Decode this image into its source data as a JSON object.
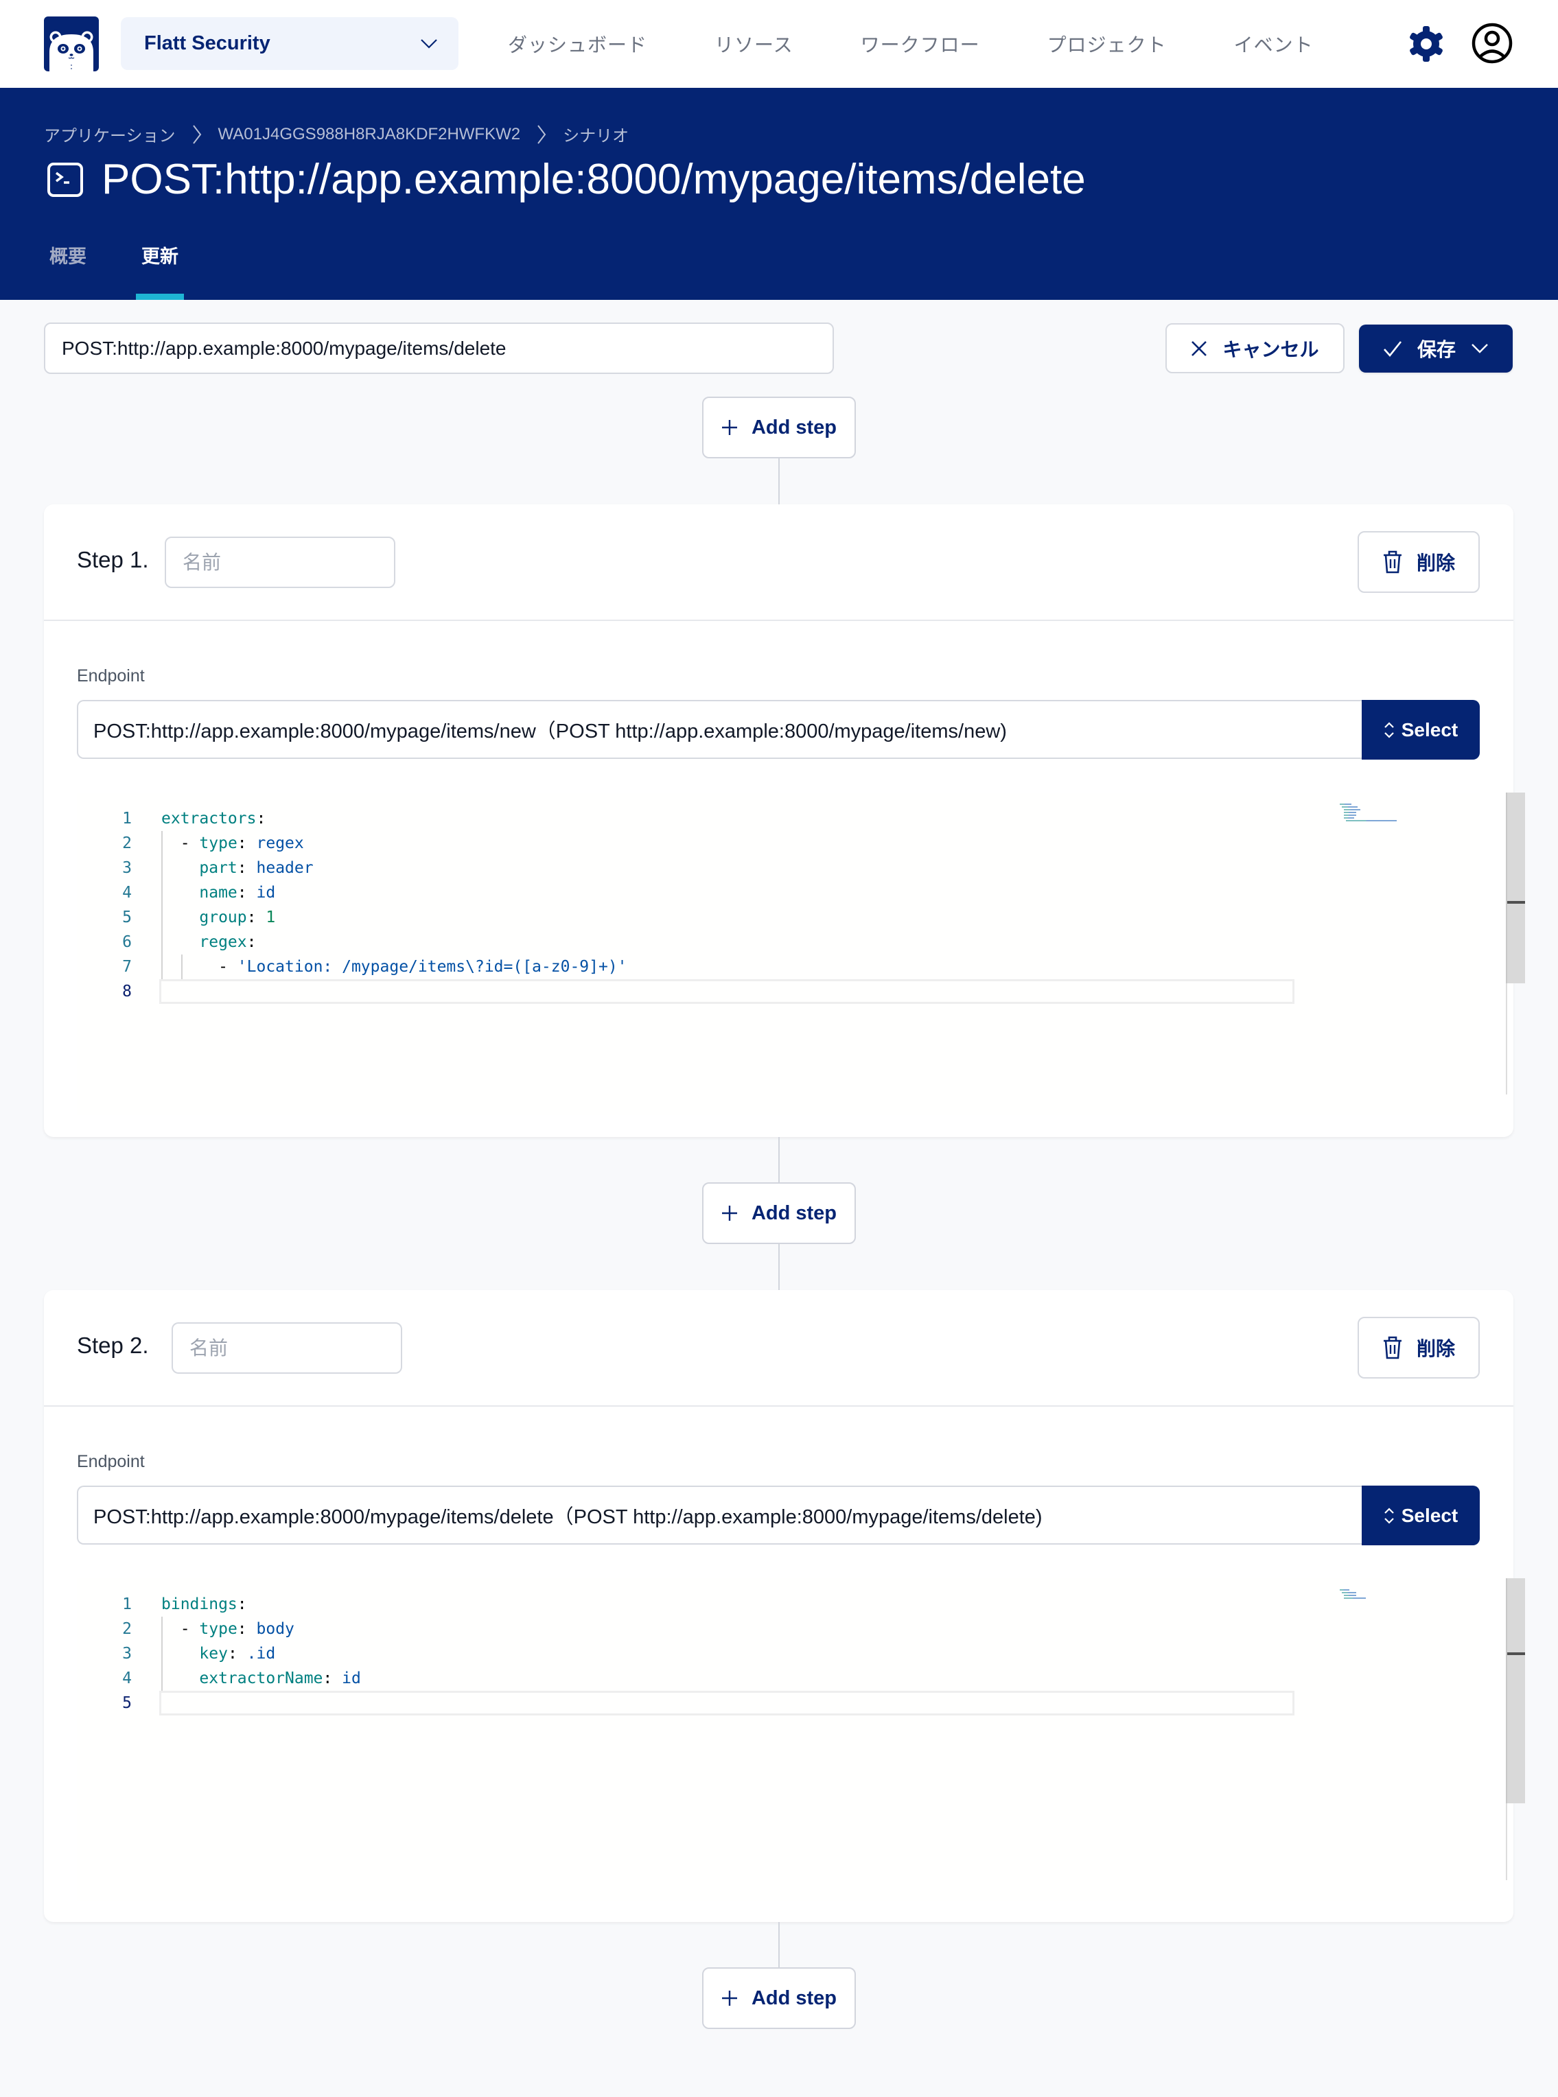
{
  "topnav": {
    "org_select": {
      "value": "Flatt Security"
    },
    "links": [
      "ダッシュボード",
      "リソース",
      "ワークフロー",
      "プロジェクト",
      "イベント"
    ],
    "icons": {
      "logo": "panda-logo",
      "settings": "gear-icon",
      "account": "user-circle-icon"
    }
  },
  "header": {
    "breadcrumb": [
      "アプリケーション",
      "WA01J4GGS988H8RJA8KDF2HWFKW2",
      "シナリオ"
    ],
    "title": "POST:http://app.example:8000/mypage/items/delete",
    "title_icon": "terminal-icon",
    "tabs": [
      {
        "label": "概要",
        "active": false
      },
      {
        "label": "更新",
        "active": true
      }
    ]
  },
  "toolbar": {
    "scenario_name": "POST:http://app.example:8000/mypage/items/delete",
    "cancel_label": "キャンセル",
    "save_label": "保存"
  },
  "add_step_label": "Add step",
  "steps": [
    {
      "label": "Step 1.",
      "name_placeholder": "名前",
      "name_value": "",
      "delete_label": "削除",
      "endpoint_label": "Endpoint",
      "endpoint_value": "POST:http://app.example:8000/mypage/items/new（POST http://app.example:8000/mypage/items/new)",
      "select_label": "Select",
      "code_lines": [
        "extractors:",
        "  - type: regex",
        "    part: header",
        "    name: id",
        "    group: 1",
        "    regex:",
        "      - 'Location: /mypage/items\\?id=([a-z0-9]+)'",
        ""
      ]
    },
    {
      "label": "Step 2.",
      "name_placeholder": "名前",
      "name_value": "",
      "delete_label": "削除",
      "endpoint_label": "Endpoint",
      "endpoint_value": "POST:http://app.example:8000/mypage/items/delete（POST http://app.example:8000/mypage/items/delete)",
      "select_label": "Select",
      "code_lines": [
        "bindings:",
        "  - type: body",
        "    key: .id",
        "    extractorName: id",
        ""
      ]
    }
  ],
  "colors": {
    "brand": "#052473",
    "tab_indicator": "#1eb4d4",
    "page_bg": "#f8f9fb",
    "yaml_key": "#008080",
    "yaml_value": "#0451a5",
    "yaml_number": "#098658"
  }
}
